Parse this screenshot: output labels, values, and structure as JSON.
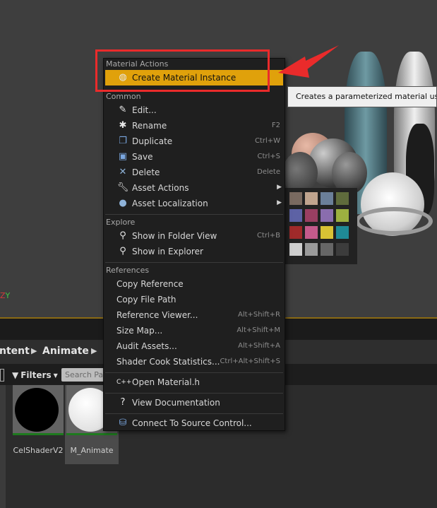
{
  "viewport": {
    "axis_label": "Z",
    "axis_label_2": "Y"
  },
  "menu": {
    "sections": [
      "Material Actions",
      "Common",
      "Explore",
      "References"
    ],
    "items": [
      {
        "label": "Create Material Instance",
        "shortcut": "",
        "icon": "material-instance-icon"
      },
      {
        "label": "Edit...",
        "shortcut": "",
        "icon": "edit-icon"
      },
      {
        "label": "Rename",
        "shortcut": "F2",
        "icon": "rename-icon"
      },
      {
        "label": "Duplicate",
        "shortcut": "Ctrl+W",
        "icon": "duplicate-icon"
      },
      {
        "label": "Save",
        "shortcut": "Ctrl+S",
        "icon": "save-icon"
      },
      {
        "label": "Delete",
        "shortcut": "Delete",
        "icon": "delete-icon"
      },
      {
        "label": "Asset Actions",
        "shortcut": "",
        "icon": "wrench-icon"
      },
      {
        "label": "Asset Localization",
        "shortcut": "",
        "icon": "globe-icon"
      },
      {
        "label": "Show in Folder View",
        "shortcut": "Ctrl+B",
        "icon": "search-icon"
      },
      {
        "label": "Show in Explorer",
        "shortcut": "",
        "icon": "search-icon"
      },
      {
        "label": "Copy Reference",
        "shortcut": ""
      },
      {
        "label": "Copy File Path",
        "shortcut": ""
      },
      {
        "label": "Reference Viewer...",
        "shortcut": "Alt+Shift+R"
      },
      {
        "label": "Size Map...",
        "shortcut": "Alt+Shift+M"
      },
      {
        "label": "Audit Assets...",
        "shortcut": "Alt+Shift+A"
      },
      {
        "label": "Shader Cook Statistics...",
        "shortcut": "Ctrl+Alt+Shift+S"
      },
      {
        "label": "Open Material.h",
        "shortcut": "",
        "icon": "code-file-icon"
      },
      {
        "label": "View Documentation",
        "shortcut": "",
        "icon": "help-icon"
      },
      {
        "label": "Connect To Source Control...",
        "shortcut": "",
        "icon": "source-control-icon"
      }
    ]
  },
  "tooltip": "Creates a parameterized material using",
  "breadcrumbs": [
    "ntent",
    "Animate"
  ],
  "toolbar": {
    "filters_label": "Filters",
    "search_placeholder": "Search Pa"
  },
  "assets": [
    {
      "name": "CelShaderV2",
      "thumb_color": "#000000"
    },
    {
      "name": "M_Animate",
      "thumb_color": "#ffffff"
    }
  ],
  "colors": {
    "highlight": "#e0a10b",
    "annotation_red": "#ea2b2b",
    "menu_bg": "#1f1f1f"
  }
}
